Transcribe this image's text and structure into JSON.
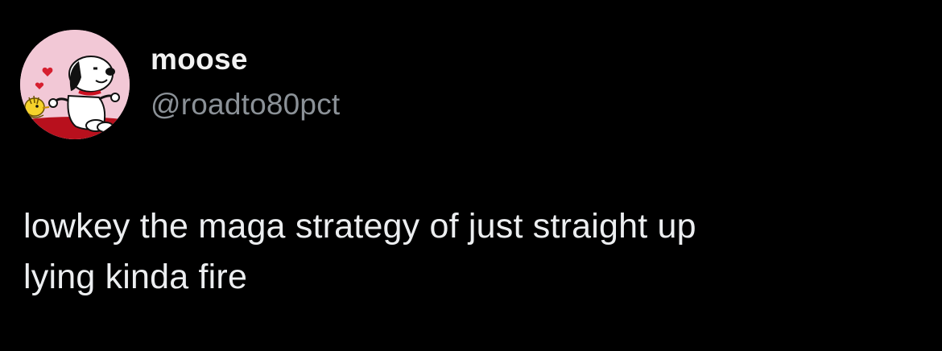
{
  "tweet": {
    "author": {
      "display_name": "moose",
      "handle": "@roadto80pct",
      "avatar_icon": "snoopy-woodstock-avatar"
    },
    "text_line_1": "lowkey the maga strategy of just straight up",
    "text_line_2": "lying kinda fire"
  },
  "colors": {
    "background": "#000000",
    "display_name": "#f2f2f2",
    "handle": "#8b9197",
    "text": "#eceef0",
    "avatar_background": "#f2c8d6"
  }
}
